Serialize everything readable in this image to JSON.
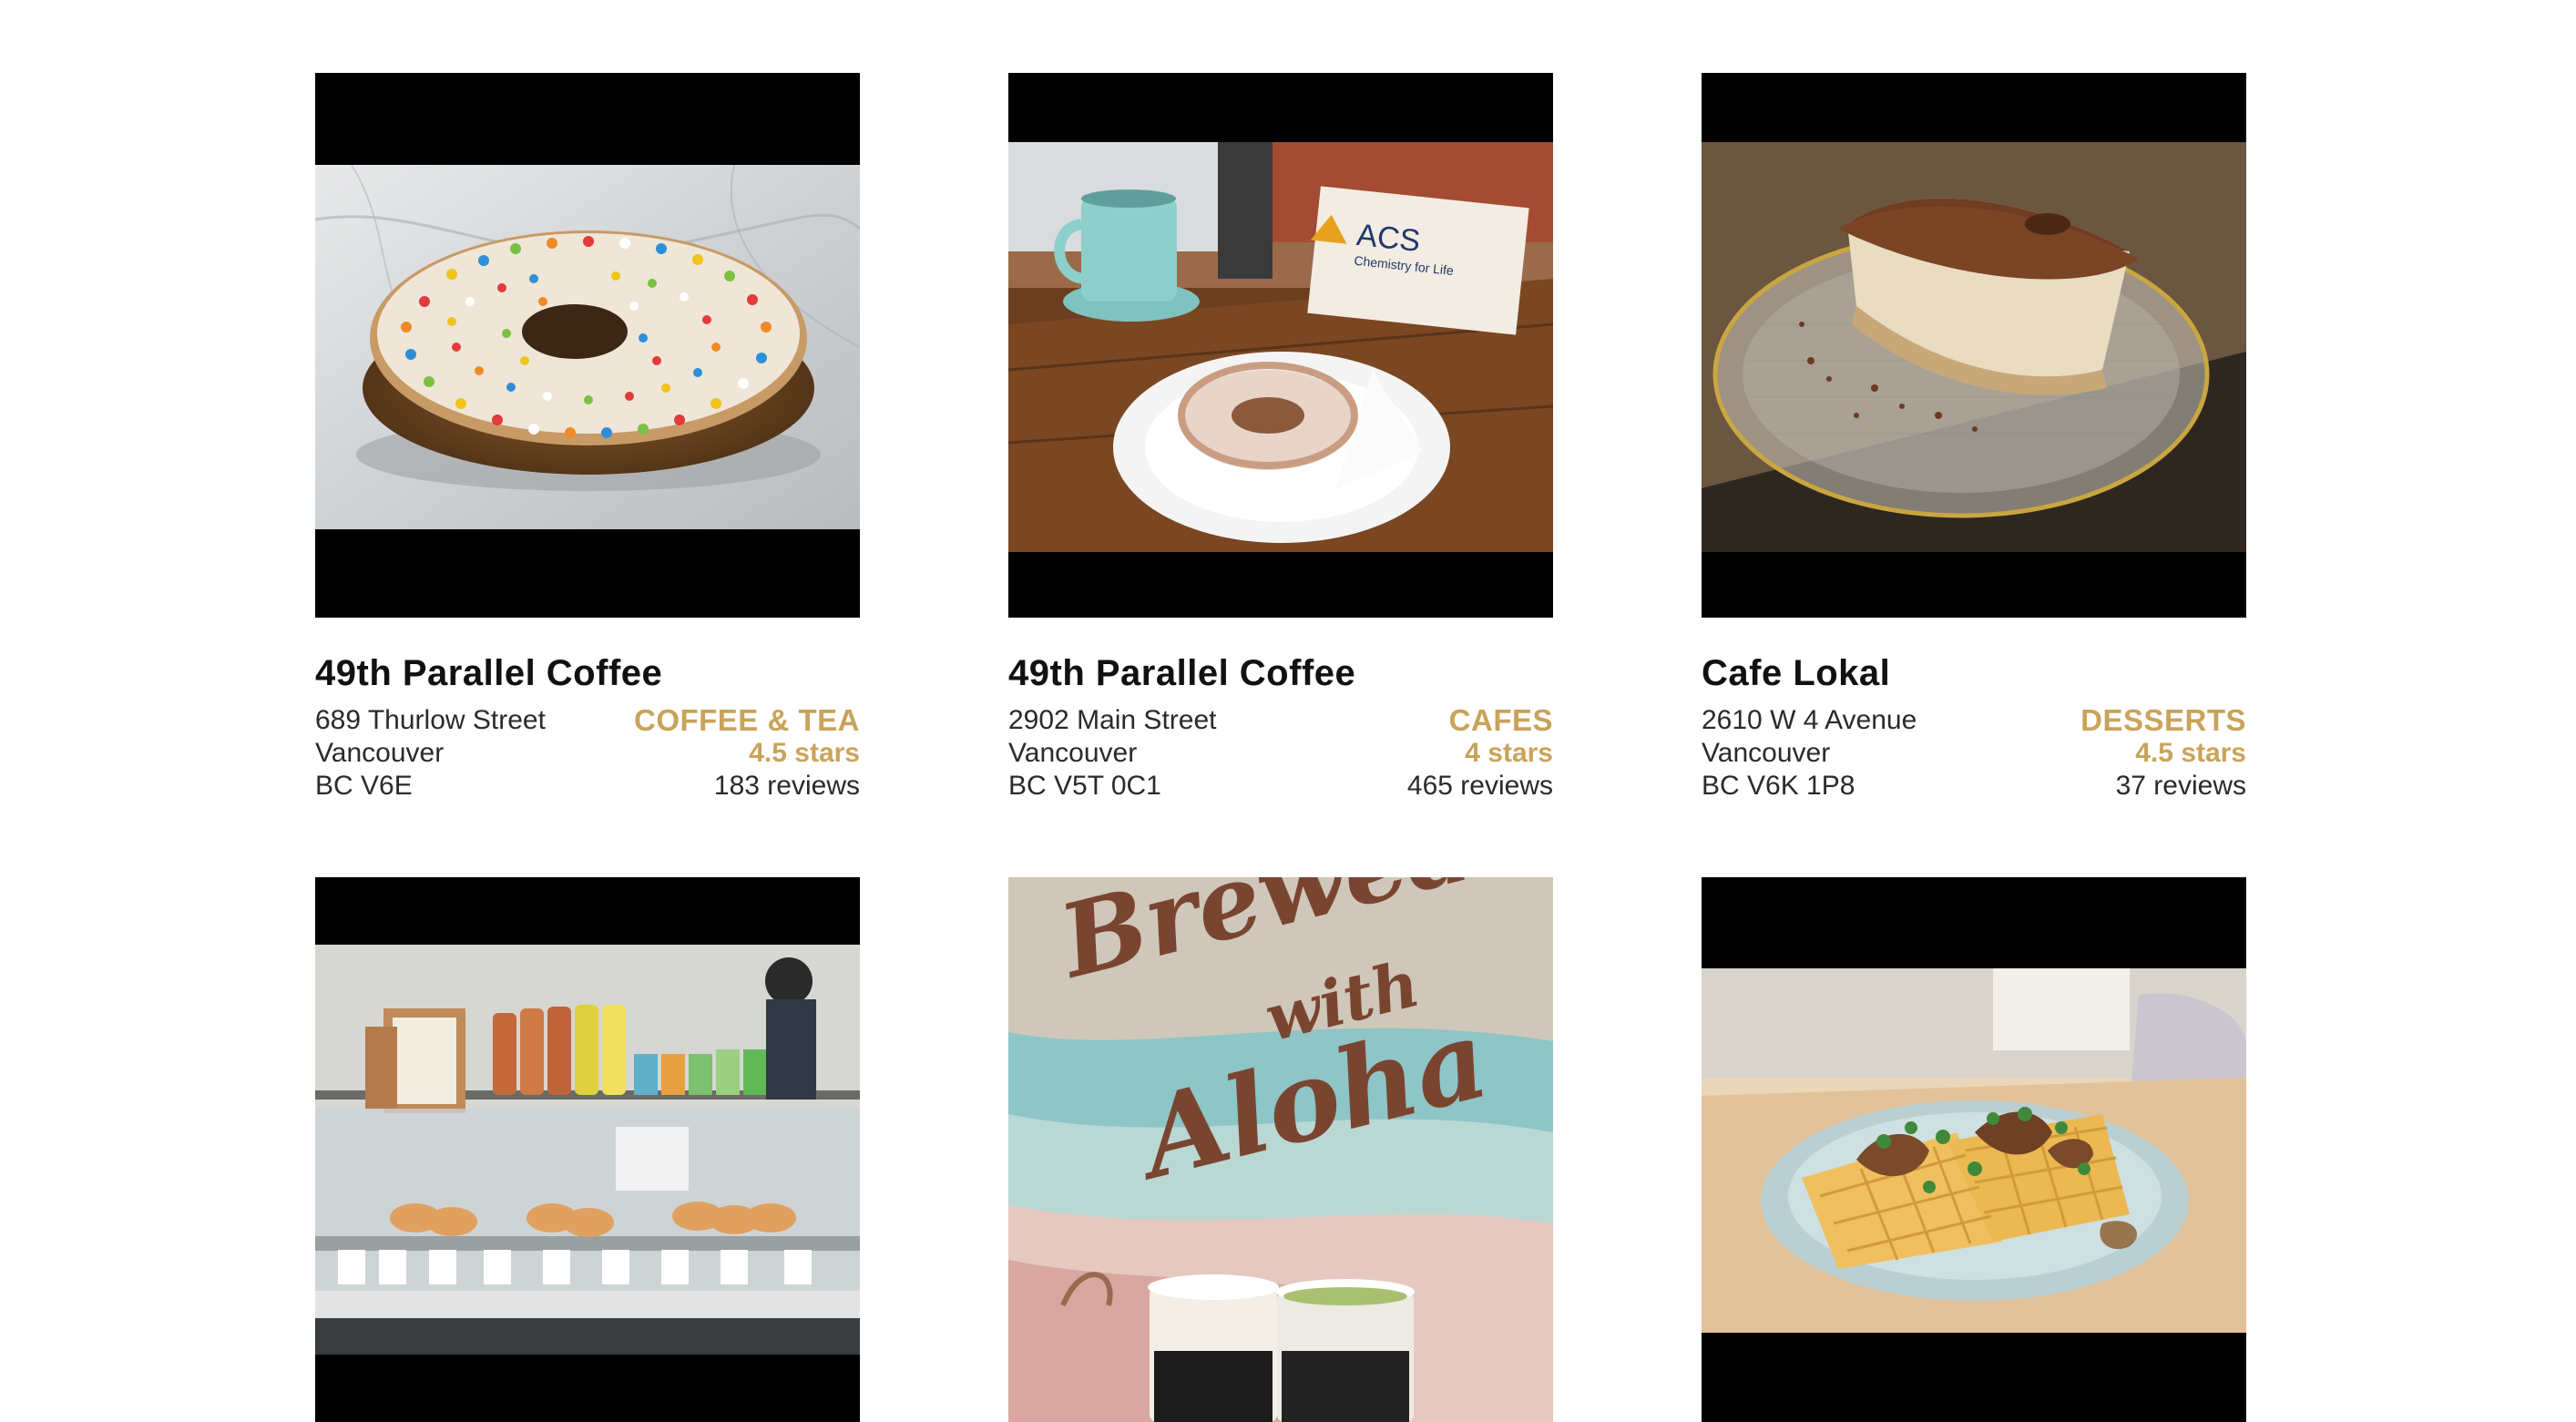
{
  "listings": [
    {
      "name": "49th Parallel Coffee",
      "address": {
        "street": "689 Thurlow Street",
        "city": "Vancouver",
        "postal": "BC V6E"
      },
      "category": "COFFEE & TEA",
      "rating": "4.5 stars",
      "reviews": "183 reviews",
      "photo_subject": "sprinkle-donut-photo"
    },
    {
      "name": "49th Parallel Coffee",
      "address": {
        "street": "2902 Main Street",
        "city": "Vancouver",
        "postal": "BC V5T 0C1"
      },
      "category": "CAFES",
      "rating": "4 stars",
      "reviews": "465 reviews",
      "photo_subject": "glazed-donut-and-mug-photo"
    },
    {
      "name": "Cafe Lokal",
      "address": {
        "street": "2610 W 4 Avenue",
        "city": "Vancouver",
        "postal": "BC V6K 1P8"
      },
      "category": "DESSERTS",
      "rating": "4.5 stars",
      "reviews": "37 reviews",
      "photo_subject": "tiramisu-photo"
    },
    {
      "photo_subject": "pastry-counter-photo"
    },
    {
      "photo_subject": "aloha-mural-drinks-photo",
      "photo_text": {
        "line1": "Brewed",
        "line2": "with",
        "line3": "Aloha"
      }
    },
    {
      "photo_subject": "waffle-plate-photo"
    }
  ],
  "colors": {
    "accent": "#c9a35a",
    "text": "#1a1a1a",
    "letterbox": "#000000",
    "background": "#ffffff"
  }
}
